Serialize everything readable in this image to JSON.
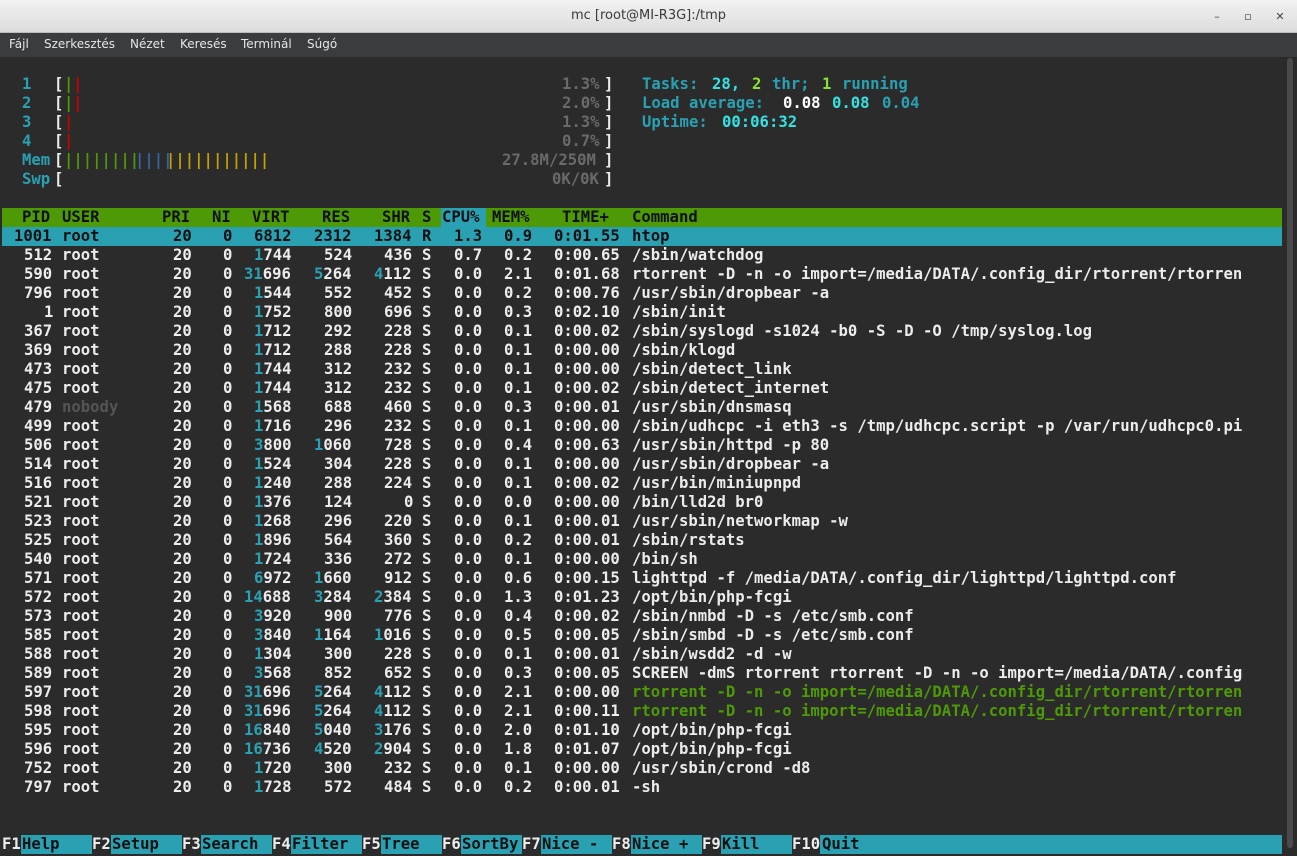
{
  "window": {
    "title": "mc [root@MI-R3G]:/tmp",
    "minimize": "–",
    "maximize": "▫",
    "close": "✕"
  },
  "menu": [
    "Fájl",
    "Szerkesztés",
    "Nézet",
    "Keresés",
    "Terminál",
    "Súgó"
  ],
  "meters": {
    "cpu": [
      {
        "label": "1",
        "value": "1.3%"
      },
      {
        "label": "2",
        "value": "2.0%"
      },
      {
        "label": "3",
        "value": "1.3%"
      },
      {
        "label": "4",
        "value": "0.7%"
      }
    ],
    "mem": {
      "label": "Mem",
      "value": "27.8M/250M"
    },
    "swp": {
      "label": "Swp",
      "value": "0K/0K"
    }
  },
  "summary": {
    "tasks_label": "Tasks:",
    "tasks": "28,",
    "threads": "2",
    "thr_label": "thr;",
    "running": "1",
    "running_label": "running",
    "load_label": "Load average:",
    "load1": "0.08",
    "load5": "0.08",
    "load15": "0.04",
    "uptime_label": "Uptime:",
    "uptime": "00:06:32"
  },
  "columns": [
    "PID",
    "USER",
    "PRI",
    "NI",
    "VIRT",
    "RES",
    "SHR",
    "S",
    "CPU%",
    "MEM%",
    "TIME+",
    "Command"
  ],
  "processes": [
    {
      "pid": "1001",
      "user": "root",
      "pri": "20",
      "ni": "0",
      "virt": "6812",
      "res": "2312",
      "shr": "1384",
      "s": "R",
      "cpu": "1.3",
      "mem": "0.9",
      "time": "0:01.55",
      "cmd": "htop"
    },
    {
      "pid": "512",
      "user": "root",
      "pri": "20",
      "ni": "0",
      "virt": "1744",
      "res": "524",
      "shr": "436",
      "s": "S",
      "cpu": "0.7",
      "mem": "0.2",
      "time": "0:00.65",
      "cmd": "/sbin/watchdog"
    },
    {
      "pid": "590",
      "user": "root",
      "pri": "20",
      "ni": "0",
      "virt": "31696",
      "res": "5264",
      "shr": "4112",
      "s": "S",
      "cpu": "0.0",
      "mem": "2.1",
      "time": "0:01.68",
      "cmd": "rtorrent -D -n -o import=/media/DATA/.config_dir/rtorrent/rtorren"
    },
    {
      "pid": "796",
      "user": "root",
      "pri": "20",
      "ni": "0",
      "virt": "1544",
      "res": "552",
      "shr": "452",
      "s": "S",
      "cpu": "0.0",
      "mem": "0.2",
      "time": "0:00.76",
      "cmd": "/usr/sbin/dropbear -a"
    },
    {
      "pid": "1",
      "user": "root",
      "pri": "20",
      "ni": "0",
      "virt": "1752",
      "res": "800",
      "shr": "696",
      "s": "S",
      "cpu": "0.0",
      "mem": "0.3",
      "time": "0:02.10",
      "cmd": "/sbin/init"
    },
    {
      "pid": "367",
      "user": "root",
      "pri": "20",
      "ni": "0",
      "virt": "1712",
      "res": "292",
      "shr": "228",
      "s": "S",
      "cpu": "0.0",
      "mem": "0.1",
      "time": "0:00.02",
      "cmd": "/sbin/syslogd -s1024 -b0 -S -D -O /tmp/syslog.log"
    },
    {
      "pid": "369",
      "user": "root",
      "pri": "20",
      "ni": "0",
      "virt": "1712",
      "res": "288",
      "shr": "228",
      "s": "S",
      "cpu": "0.0",
      "mem": "0.1",
      "time": "0:00.00",
      "cmd": "/sbin/klogd"
    },
    {
      "pid": "473",
      "user": "root",
      "pri": "20",
      "ni": "0",
      "virt": "1744",
      "res": "312",
      "shr": "232",
      "s": "S",
      "cpu": "0.0",
      "mem": "0.1",
      "time": "0:00.00",
      "cmd": "/sbin/detect_link"
    },
    {
      "pid": "475",
      "user": "root",
      "pri": "20",
      "ni": "0",
      "virt": "1744",
      "res": "312",
      "shr": "232",
      "s": "S",
      "cpu": "0.0",
      "mem": "0.1",
      "time": "0:00.02",
      "cmd": "/sbin/detect_internet"
    },
    {
      "pid": "479",
      "user": "nobody",
      "pri": "20",
      "ni": "0",
      "virt": "1568",
      "res": "688",
      "shr": "460",
      "s": "S",
      "cpu": "0.0",
      "mem": "0.3",
      "time": "0:00.01",
      "cmd": "/usr/sbin/dnsmasq"
    },
    {
      "pid": "499",
      "user": "root",
      "pri": "20",
      "ni": "0",
      "virt": "1716",
      "res": "296",
      "shr": "232",
      "s": "S",
      "cpu": "0.0",
      "mem": "0.1",
      "time": "0:00.00",
      "cmd": "/sbin/udhcpc -i eth3 -s /tmp/udhcpc.script -p /var/run/udhcpc0.pi"
    },
    {
      "pid": "506",
      "user": "root",
      "pri": "20",
      "ni": "0",
      "virt": "3800",
      "res": "1060",
      "shr": "728",
      "s": "S",
      "cpu": "0.0",
      "mem": "0.4",
      "time": "0:00.63",
      "cmd": "/usr/sbin/httpd -p 80"
    },
    {
      "pid": "514",
      "user": "root",
      "pri": "20",
      "ni": "0",
      "virt": "1524",
      "res": "304",
      "shr": "228",
      "s": "S",
      "cpu": "0.0",
      "mem": "0.1",
      "time": "0:00.00",
      "cmd": "/usr/sbin/dropbear -a"
    },
    {
      "pid": "516",
      "user": "root",
      "pri": "20",
      "ni": "0",
      "virt": "1240",
      "res": "288",
      "shr": "224",
      "s": "S",
      "cpu": "0.0",
      "mem": "0.1",
      "time": "0:00.02",
      "cmd": "/usr/bin/miniupnpd"
    },
    {
      "pid": "521",
      "user": "root",
      "pri": "20",
      "ni": "0",
      "virt": "1376",
      "res": "124",
      "shr": "0",
      "s": "S",
      "cpu": "0.0",
      "mem": "0.0",
      "time": "0:00.00",
      "cmd": "/bin/lld2d br0"
    },
    {
      "pid": "523",
      "user": "root",
      "pri": "20",
      "ni": "0",
      "virt": "1268",
      "res": "296",
      "shr": "220",
      "s": "S",
      "cpu": "0.0",
      "mem": "0.1",
      "time": "0:00.01",
      "cmd": "/usr/sbin/networkmap -w"
    },
    {
      "pid": "525",
      "user": "root",
      "pri": "20",
      "ni": "0",
      "virt": "1896",
      "res": "564",
      "shr": "360",
      "s": "S",
      "cpu": "0.0",
      "mem": "0.2",
      "time": "0:00.01",
      "cmd": "/sbin/rstats"
    },
    {
      "pid": "540",
      "user": "root",
      "pri": "20",
      "ni": "0",
      "virt": "1724",
      "res": "336",
      "shr": "272",
      "s": "S",
      "cpu": "0.0",
      "mem": "0.1",
      "time": "0:00.00",
      "cmd": "/bin/sh"
    },
    {
      "pid": "571",
      "user": "root",
      "pri": "20",
      "ni": "0",
      "virt": "6972",
      "res": "1660",
      "shr": "912",
      "s": "S",
      "cpu": "0.0",
      "mem": "0.6",
      "time": "0:00.15",
      "cmd": "lighttpd -f /media/DATA/.config_dir/lighttpd/lighttpd.conf"
    },
    {
      "pid": "572",
      "user": "root",
      "pri": "20",
      "ni": "0",
      "virt": "14688",
      "res": "3284",
      "shr": "2384",
      "s": "S",
      "cpu": "0.0",
      "mem": "1.3",
      "time": "0:01.23",
      "cmd": "/opt/bin/php-fcgi"
    },
    {
      "pid": "573",
      "user": "root",
      "pri": "20",
      "ni": "0",
      "virt": "3920",
      "res": "900",
      "shr": "776",
      "s": "S",
      "cpu": "0.0",
      "mem": "0.4",
      "time": "0:00.02",
      "cmd": "/sbin/nmbd -D -s /etc/smb.conf"
    },
    {
      "pid": "585",
      "user": "root",
      "pri": "20",
      "ni": "0",
      "virt": "3840",
      "res": "1164",
      "shr": "1016",
      "s": "S",
      "cpu": "0.0",
      "mem": "0.5",
      "time": "0:00.05",
      "cmd": "/sbin/smbd -D -s /etc/smb.conf"
    },
    {
      "pid": "588",
      "user": "root",
      "pri": "20",
      "ni": "0",
      "virt": "1304",
      "res": "300",
      "shr": "228",
      "s": "S",
      "cpu": "0.0",
      "mem": "0.1",
      "time": "0:00.01",
      "cmd": "/sbin/wsdd2 -d -w"
    },
    {
      "pid": "589",
      "user": "root",
      "pri": "20",
      "ni": "0",
      "virt": "3568",
      "res": "852",
      "shr": "652",
      "s": "S",
      "cpu": "0.0",
      "mem": "0.3",
      "time": "0:00.05",
      "cmd": "SCREEN -dmS rtorrent rtorrent -D -n -o import=/media/DATA/.config"
    },
    {
      "pid": "597",
      "user": "root",
      "pri": "20",
      "ni": "0",
      "virt": "31696",
      "res": "5264",
      "shr": "4112",
      "s": "S",
      "cpu": "0.0",
      "mem": "2.1",
      "time": "0:00.00",
      "cmd": "rtorrent -D -n -o import=/media/DATA/.config_dir/rtorrent/rtorren",
      "thread": true
    },
    {
      "pid": "598",
      "user": "root",
      "pri": "20",
      "ni": "0",
      "virt": "31696",
      "res": "5264",
      "shr": "4112",
      "s": "S",
      "cpu": "0.0",
      "mem": "2.1",
      "time": "0:00.11",
      "cmd": "rtorrent -D -n -o import=/media/DATA/.config_dir/rtorrent/rtorren",
      "thread": true
    },
    {
      "pid": "595",
      "user": "root",
      "pri": "20",
      "ni": "0",
      "virt": "16840",
      "res": "5040",
      "shr": "3176",
      "s": "S",
      "cpu": "0.0",
      "mem": "2.0",
      "time": "0:01.10",
      "cmd": "/opt/bin/php-fcgi"
    },
    {
      "pid": "596",
      "user": "root",
      "pri": "20",
      "ni": "0",
      "virt": "16736",
      "res": "4520",
      "shr": "2904",
      "s": "S",
      "cpu": "0.0",
      "mem": "1.8",
      "time": "0:01.07",
      "cmd": "/opt/bin/php-fcgi"
    },
    {
      "pid": "752",
      "user": "root",
      "pri": "20",
      "ni": "0",
      "virt": "1720",
      "res": "300",
      "shr": "232",
      "s": "S",
      "cpu": "0.0",
      "mem": "0.1",
      "time": "0:00.00",
      "cmd": "/usr/sbin/crond -d8"
    },
    {
      "pid": "797",
      "user": "root",
      "pri": "20",
      "ni": "0",
      "virt": "1728",
      "res": "572",
      "shr": "484",
      "s": "S",
      "cpu": "0.0",
      "mem": "0.2",
      "time": "0:00.01",
      "cmd": "-sh"
    }
  ],
  "fkeys": [
    {
      "key": "F1",
      "label": "Help"
    },
    {
      "key": "F2",
      "label": "Setup"
    },
    {
      "key": "F3",
      "label": "Search"
    },
    {
      "key": "F4",
      "label": "Filter"
    },
    {
      "key": "F5",
      "label": "Tree"
    },
    {
      "key": "F6",
      "label": "SortBy"
    },
    {
      "key": "F7",
      "label": "Nice -"
    },
    {
      "key": "F8",
      "label": "Nice +"
    },
    {
      "key": "F9",
      "label": "Kill"
    },
    {
      "key": "F10",
      "label": "Quit"
    }
  ]
}
